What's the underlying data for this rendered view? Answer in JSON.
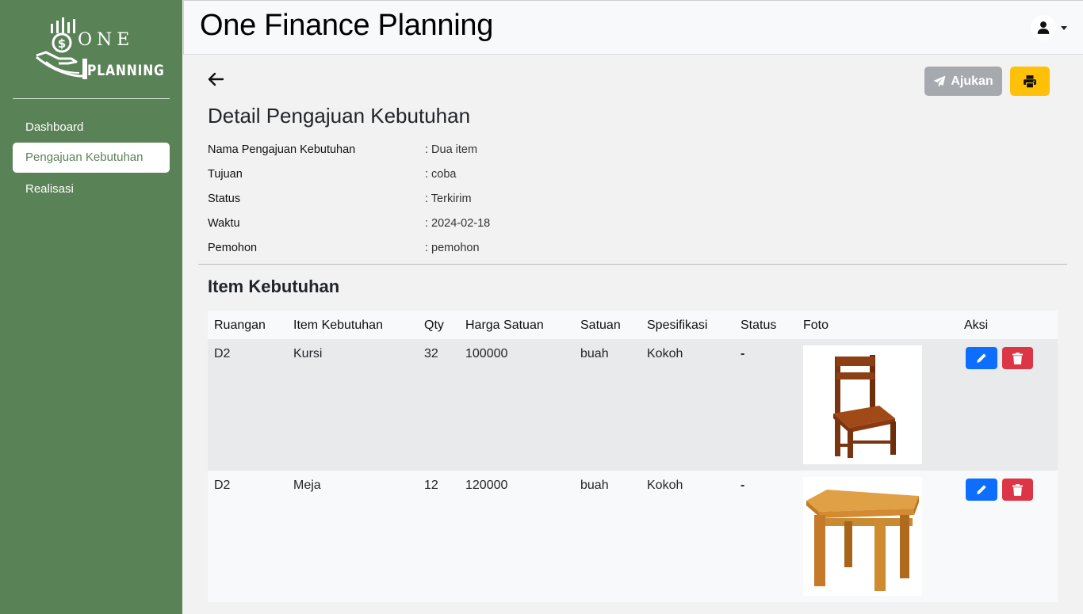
{
  "app": {
    "title": "One Finance Planning",
    "logo_top": "ONE",
    "logo_bottom": "PLANNING"
  },
  "sidebar": {
    "items": [
      {
        "label": "Dashboard",
        "active": false
      },
      {
        "label": "Pengajuan Kebutuhan",
        "active": true
      },
      {
        "label": "Realisasi",
        "active": false
      }
    ]
  },
  "toolbar": {
    "submit_label": "Ajukan",
    "submit_icon": "paper-plane-icon",
    "print_icon": "print-icon",
    "back_icon": "arrow-left-icon"
  },
  "detail": {
    "title": "Detail Pengajuan Kebutuhan",
    "fields": [
      {
        "label": "Nama Pengajuan Kebutuhan",
        "value": ": Dua item"
      },
      {
        "label": "Tujuan",
        "value": ": coba"
      },
      {
        "label": "Status",
        "value": ": Terkirim"
      },
      {
        "label": "Waktu",
        "value": ": 2024-02-18"
      },
      {
        "label": "Pemohon",
        "value": ": pemohon"
      }
    ]
  },
  "items": {
    "title": "Item Kebutuhan",
    "columns": [
      "Ruangan",
      "Item Kebutuhan",
      "Qty",
      "Harga Satuan",
      "Satuan",
      "Spesifikasi",
      "Status",
      "Foto",
      "Aksi"
    ],
    "rows": [
      {
        "ruangan": "D2",
        "item": "Kursi",
        "qty": "32",
        "harga": "100000",
        "satuan": "buah",
        "spesifikasi": "Kokoh",
        "status": "-",
        "foto": "chair-photo"
      },
      {
        "ruangan": "D2",
        "item": "Meja",
        "qty": "12",
        "harga": "120000",
        "satuan": "buah",
        "spesifikasi": "Kokoh",
        "status": "-",
        "foto": "table-photo"
      }
    ]
  },
  "colors": {
    "sidebar": "#5a8257",
    "submit_button": "#a6a9ad",
    "print_button": "#ffc107",
    "edit_button": "#0d6efd",
    "delete_button": "#dc3545"
  }
}
